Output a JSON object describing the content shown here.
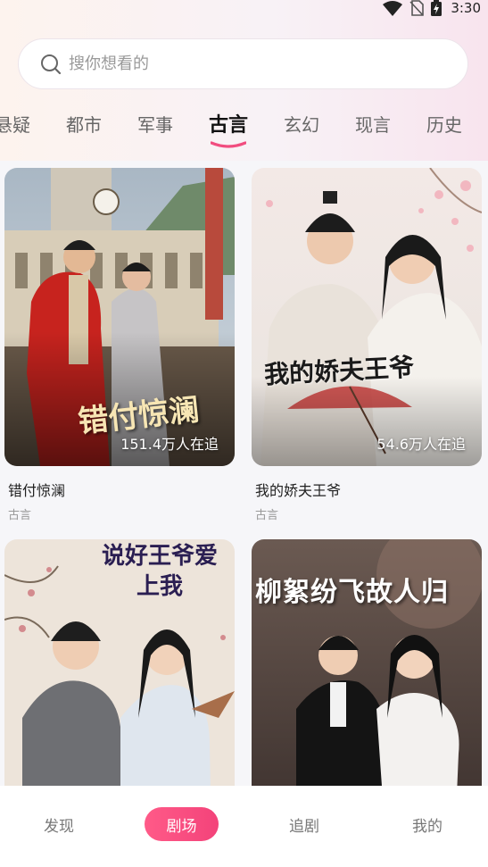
{
  "status_bar": {
    "time": "3:30"
  },
  "search": {
    "placeholder": "搜你想看的"
  },
  "tabs": [
    {
      "label": "悬疑"
    },
    {
      "label": "都市"
    },
    {
      "label": "军事"
    },
    {
      "label": "古言",
      "active": true
    },
    {
      "label": "玄幻"
    },
    {
      "label": "现言"
    },
    {
      "label": "历史"
    }
  ],
  "dramas": [
    {
      "poster_title": "错付惊澜",
      "follow_count": "151.4万人在追",
      "name": "错付惊澜",
      "genre": "古言"
    },
    {
      "poster_title": "我的娇夫王爷",
      "follow_count": "54.6万人在追",
      "name": "我的娇夫王爷",
      "genre": "古言"
    },
    {
      "poster_title": "说好王爷爱上我",
      "follow_count": "",
      "name": "",
      "genre": ""
    },
    {
      "poster_title": "柳絮纷飞故人归",
      "follow_count": "",
      "name": "",
      "genre": ""
    }
  ],
  "bottom_nav": [
    {
      "label": "发现"
    },
    {
      "label": "剧场",
      "active": true
    },
    {
      "label": "追剧"
    },
    {
      "label": "我的"
    }
  ],
  "colors": {
    "accent": "#f3437a",
    "tab_underline": "#f14d7f"
  },
  "icons": [
    "wifi-icon",
    "no-sim-icon",
    "battery-charging-icon",
    "search-icon"
  ]
}
